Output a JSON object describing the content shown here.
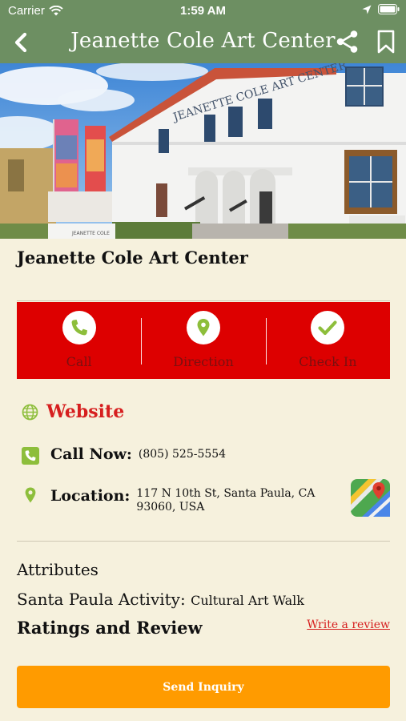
{
  "status": {
    "carrier": "Carrier",
    "time": "1:59 AM"
  },
  "nav": {
    "title": "Jeanette Cole Art Center"
  },
  "hero": {
    "sign_text": "JEANETTE COLE ART CENTER",
    "plaque_text": "JEANETTE COLE"
  },
  "place": {
    "title": "Jeanette Cole Art Center"
  },
  "actions": [
    {
      "label": "Call",
      "icon": "phone-icon"
    },
    {
      "label": "Direction",
      "icon": "map-pin-icon"
    },
    {
      "label": "Check In",
      "icon": "check-icon"
    }
  ],
  "website": {
    "label": "Website"
  },
  "call_now": {
    "label": "Call Now:",
    "value": "(805) 525-5554"
  },
  "location": {
    "label": "Location:",
    "line1": "117 N 10th St, Santa Paula, CA",
    "line2": "93060, USA"
  },
  "attributes": {
    "heading": "Attributes",
    "key": "Santa Paula Activity:",
    "value": "Cultural Art Walk"
  },
  "ratings": {
    "heading": "Ratings and Review",
    "write_link": "Write a review"
  },
  "send_inquiry": {
    "label": "Send Inquiry"
  },
  "colors": {
    "nav": "#6d8f62",
    "action_bar": "#dd0000",
    "accent_red": "#d61f1f",
    "button": "#ff9b00",
    "icon_green": "#8dbe3b",
    "background": "#f6f1dd"
  }
}
